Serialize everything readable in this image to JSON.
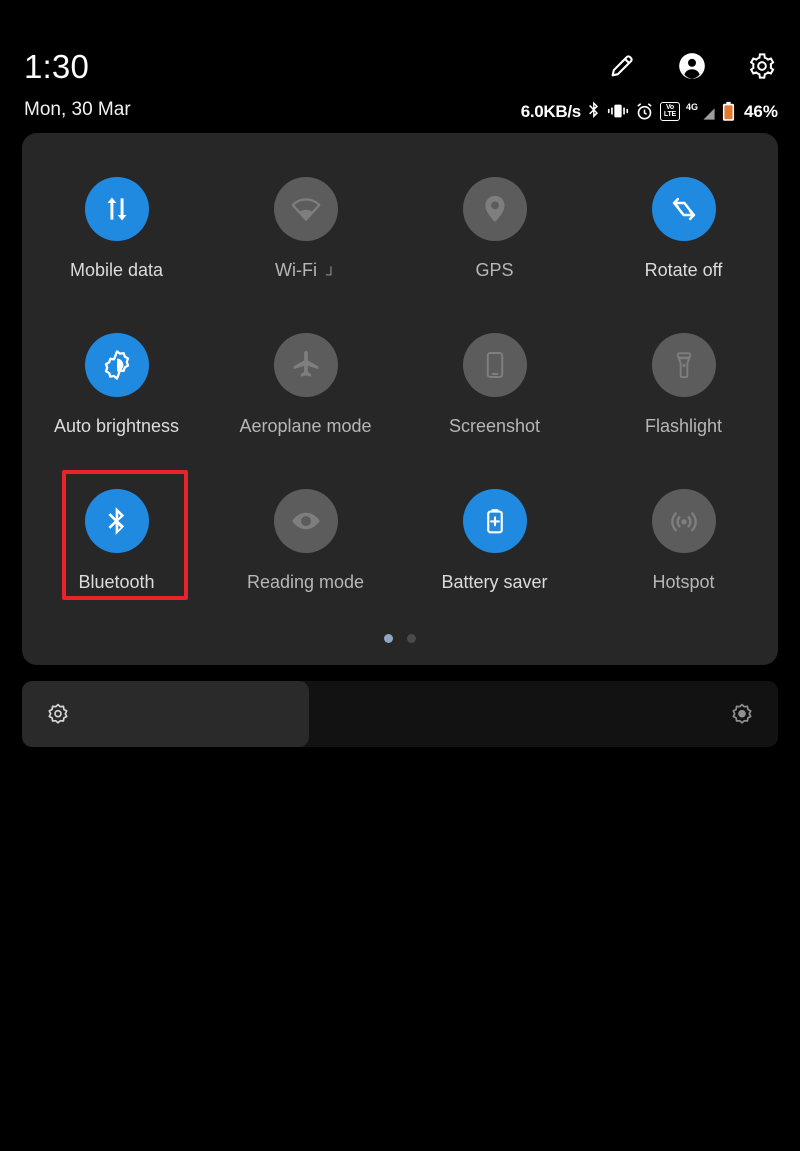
{
  "header": {
    "clock": "1:30",
    "date": "Mon, 30 Mar",
    "actions": [
      {
        "name": "edit-icon",
        "label": "Edit"
      },
      {
        "name": "user-account-icon",
        "label": "Account"
      },
      {
        "name": "settings-gear-icon",
        "label": "Settings"
      }
    ]
  },
  "statusbar": {
    "network_speed": "6.0KB/s",
    "bluetooth_icon": "bluetooth",
    "vibrate_icon": "vibrate",
    "alarm_icon": "alarm",
    "volte_top": "Vo",
    "volte_bottom": "LTE",
    "network_type": "4G",
    "battery_icon": "battery",
    "battery_percent": "46%"
  },
  "quick_settings": {
    "rows": [
      [
        {
          "label": "Mobile data",
          "icon": "mobile-data-icon",
          "active": true,
          "expandable": false
        },
        {
          "label": "Wi-Fi",
          "icon": "wifi-icon",
          "active": false,
          "expandable": true
        },
        {
          "label": "GPS",
          "icon": "gps-location-icon",
          "active": false,
          "expandable": false
        },
        {
          "label": "Rotate off",
          "icon": "screen-rotate-icon",
          "active": true,
          "expandable": false
        }
      ],
      [
        {
          "label": "Auto brightness",
          "icon": "auto-brightness-icon",
          "active": true,
          "expandable": false
        },
        {
          "label": "Aeroplane mode",
          "icon": "aeroplane-icon",
          "active": false,
          "expandable": false
        },
        {
          "label": "Screenshot",
          "icon": "screenshot-icon",
          "active": false,
          "expandable": false
        },
        {
          "label": "Flashlight",
          "icon": "flashlight-icon",
          "active": false,
          "expandable": false
        }
      ],
      [
        {
          "label": "Bluetooth",
          "icon": "bluetooth-icon",
          "active": true,
          "expandable": false,
          "highlighted": true
        },
        {
          "label": "Reading mode",
          "icon": "reading-mode-eye-icon",
          "active": false,
          "expandable": false
        },
        {
          "label": "Battery saver",
          "icon": "battery-saver-icon",
          "active": true,
          "expandable": false
        },
        {
          "label": "Hotspot",
          "icon": "hotspot-icon",
          "active": false,
          "expandable": false
        }
      ]
    ],
    "expand_mark": "┘",
    "pages": {
      "count": 2,
      "active_index": 0
    }
  },
  "brightness": {
    "level_percent": 38,
    "left_icon": "brightness-low-icon",
    "right_icon": "brightness-high-icon"
  },
  "colors": {
    "accent_blue": "#2089E0",
    "inactive_gray": "#5C5C5C",
    "panel_bg": "#272727",
    "screen_bg": "#000000",
    "highlight_red": "#E8232A",
    "label_text": "#DCDCDC"
  }
}
